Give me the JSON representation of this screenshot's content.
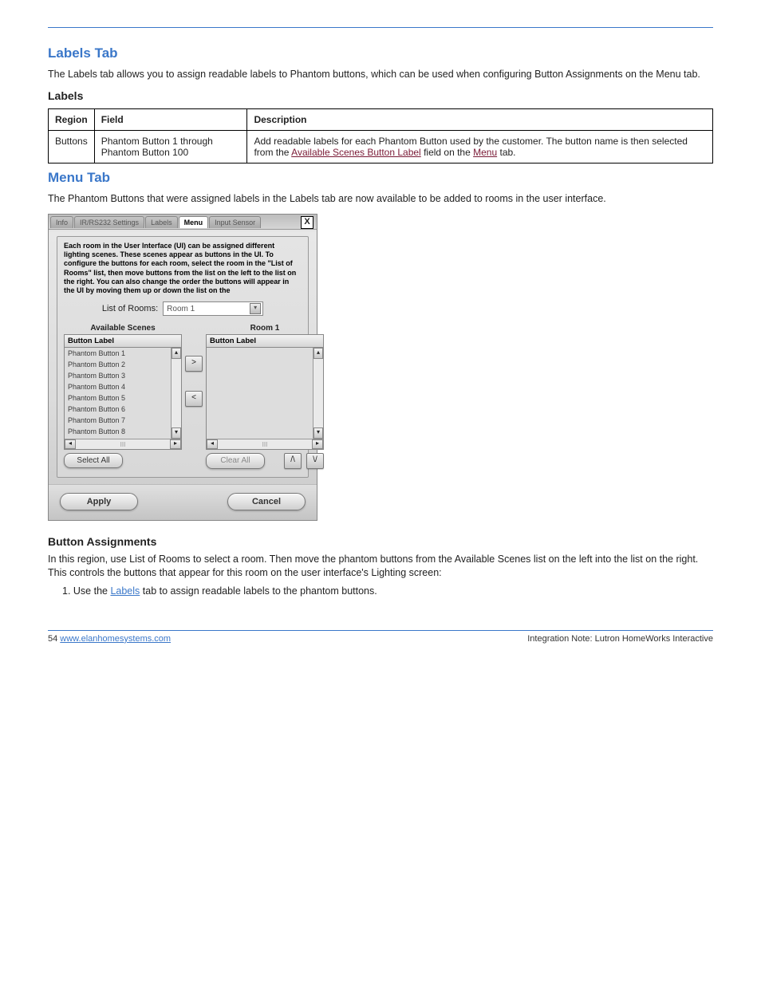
{
  "doc": {
    "labels_section": {
      "title": "Labels Tab",
      "p1": "The Labels tab allows you to assign readable labels to Phantom buttons, which can be used when configuring Button Assignments on the Menu tab.",
      "table": {
        "headers": [
          "Region",
          "Field",
          "Description"
        ],
        "rows": [
          {
            "region": "Buttons",
            "field": "Phantom Button 1 through Phantom Button 100",
            "desc_lead": "Add readable labels for each Phantom Button used by the customer. The button name is then selected from the ",
            "desc_link1": "Available Scenes Button Label",
            "desc_mid1": " field on the ",
            "desc_link2": "Menu",
            "desc_trail": " tab."
          }
        ]
      }
    },
    "menu_section": {
      "title": "Menu Tab",
      "p1": "The Phantom Buttons that were assigned labels in the Labels tab are now available to be added to rooms in the user interface."
    },
    "dialog": {
      "tabs": [
        "Info",
        "IR/RS232 Settings",
        "Labels",
        "Menu",
        "Input Sensor"
      ],
      "active_tab_index": 3,
      "close": "X",
      "intro": "Each room in the User Interface (UI) can be assigned different lighting scenes.  These scenes appear as buttons in the UI.  To configure the buttons for each room, select the room in the \"List of Rooms\" list, then move buttons from the list on the left to the list on the right.  You can also change the order the buttons will appear in the UI by moving them up or down the list on the",
      "rooms_label": "List of Rooms:",
      "rooms_selected": "Room 1",
      "left_head": "Available Scenes",
      "right_head": "Room 1",
      "col_header": "Button Label",
      "items": [
        "Phantom Button 1",
        "Phantom Button 2",
        "Phantom Button 3",
        "Phantom Button 4",
        "Phantom Button 5",
        "Phantom Button 6",
        "Phantom Button 7"
      ],
      "item_cut": "Phantom Button 8",
      "move_right": ">",
      "move_left": "<",
      "select_all": "Select All",
      "clear_all": "Clear All",
      "move_up": "/\\",
      "move_down": "\\/",
      "apply": "Apply",
      "cancel": "Cancel",
      "htrack": "III"
    },
    "after_dialog": {
      "heading": "Button Assignments",
      "p1": "In this region, use List of Rooms to select a room. Then move the phantom buttons from the Available Scenes list on the left into the list on the right. This controls the buttons that appear for this room on the user interface's Lighting screen:",
      "step1_lead": "1. Use the ",
      "step1_link": "Labels",
      "step1_trail": " tab to assign readable labels to the phantom buttons."
    },
    "footer": {
      "left": "54 ",
      "link": "www.elanhomesystems.com",
      "right": "Integration Note: Lutron HomeWorks Interactive"
    }
  }
}
